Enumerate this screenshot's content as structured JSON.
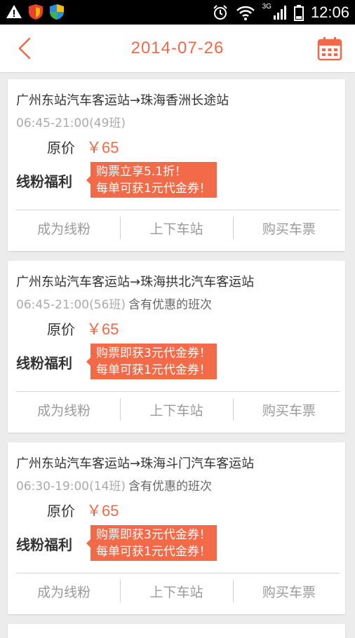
{
  "status_bar": {
    "time": "12:06",
    "network": "3G",
    "icons": [
      "warning-icon",
      "shield-icon",
      "shield-icon",
      "alarm-icon",
      "wifi-icon",
      "signal-icon",
      "battery-icon"
    ]
  },
  "header": {
    "date": "2014-07-26",
    "back_icon": "chevron-left-icon",
    "calendar_icon": "calendar-icon",
    "accent_color": "#f06a4a"
  },
  "routes": [
    {
      "route": "广州东站汽车客运站→珠海香洲长途站",
      "time_range": "06:45-21:00(49班)",
      "note": "",
      "price_label": "原价",
      "price": "￥65",
      "benefit_label": "线粉福利",
      "promo_line1": "购票立享5.1折！",
      "promo_line2": "每单可获1元代金券！",
      "actions": [
        "成为线粉",
        "上下车站",
        "购买车票"
      ]
    },
    {
      "route": "广州东站汽车客运站→珠海拱北汽车客运站",
      "time_range": "06:45-21:00(56班)",
      "note": "含有优惠的班次",
      "price_label": "原价",
      "price": "￥65",
      "benefit_label": "线粉福利",
      "promo_line1": "购票即获3元代金券！",
      "promo_line2": "每单可获1元代金券！",
      "actions": [
        "成为线粉",
        "上下车站",
        "购买车票"
      ]
    },
    {
      "route": "广州东站汽车客运站→珠海斗门汽车客运站",
      "time_range": "06:30-19:00(14班)",
      "note": "含有优惠的班次",
      "price_label": "原价",
      "price": "￥65",
      "benefit_label": "线粉福利",
      "promo_line1": "购票即获3元代金券！",
      "promo_line2": "每单可获1元代金券！",
      "actions": [
        "成为线粉",
        "上下车站",
        "购买车票"
      ]
    }
  ]
}
